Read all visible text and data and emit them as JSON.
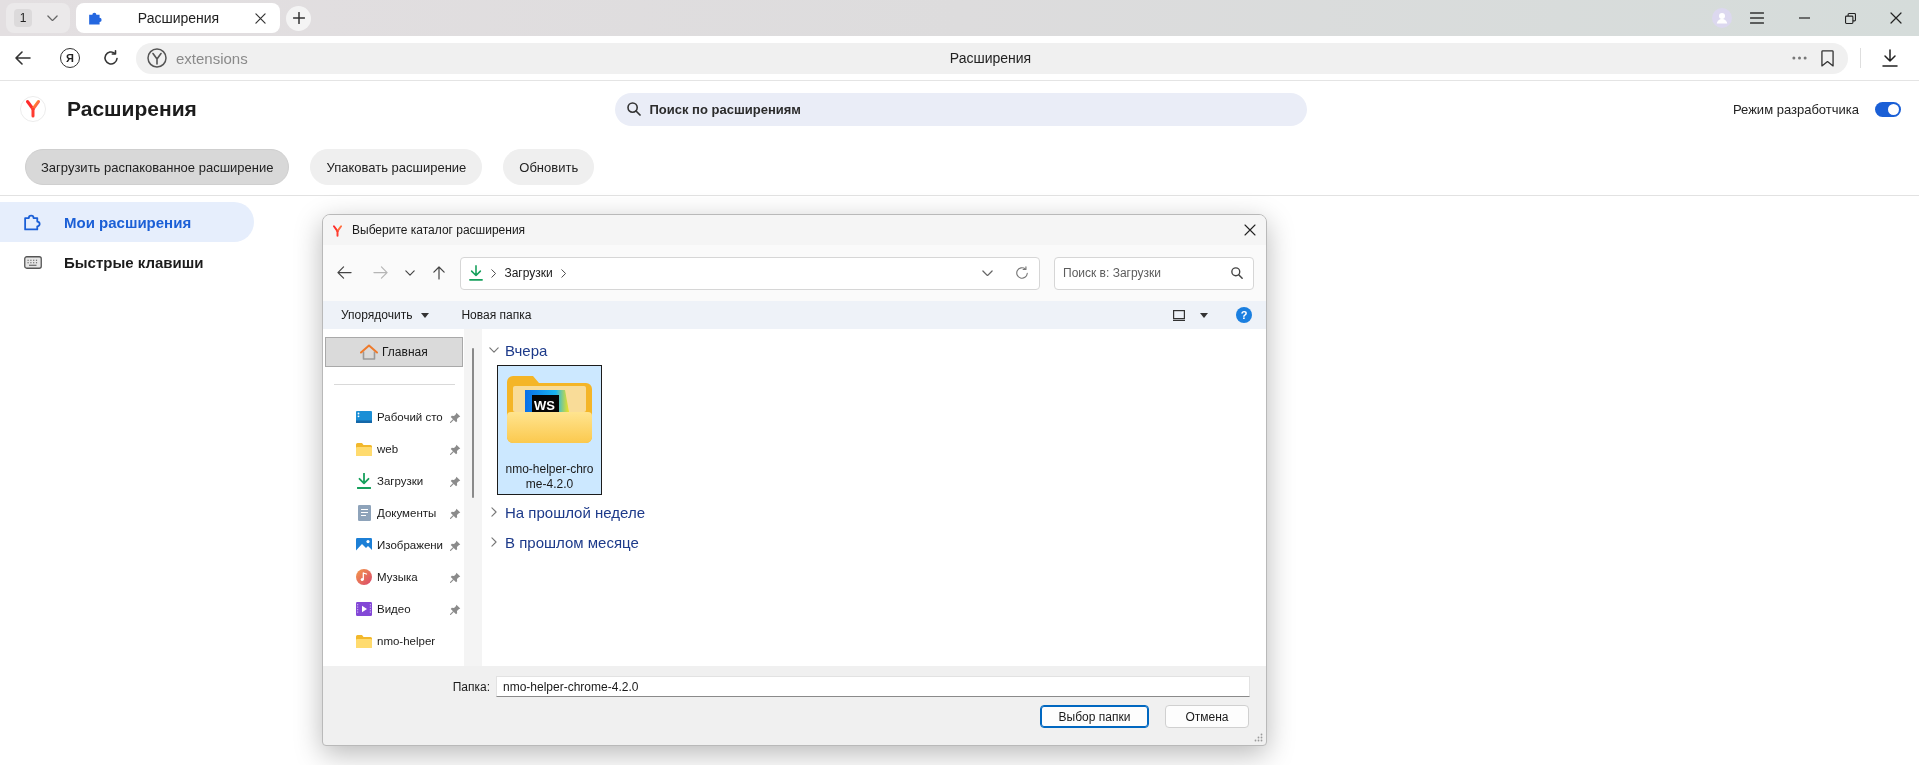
{
  "browser": {
    "tab_counter": "1",
    "tabs": [
      {
        "title": "Расширения",
        "selected": true
      }
    ],
    "yandex_button": "Я",
    "address": "extensions",
    "page_title": "Расширения"
  },
  "header": {
    "title": "Расширения",
    "search": {
      "placeholder": "Поиск по расширениям"
    },
    "developer_mode": {
      "label": "Режим разработчика",
      "on": true
    }
  },
  "actions": [
    {
      "label": "Загрузить распакованное расширение",
      "pressed": true
    },
    {
      "label": "Упаковать расширение",
      "pressed": false
    },
    {
      "label": "Обновить",
      "pressed": false
    }
  ],
  "sidebar": {
    "items": [
      {
        "label": "Мои расширения",
        "kind": "extensions",
        "selected": true
      },
      {
        "label": "Быстрые клавиши",
        "kind": "shortcuts",
        "selected": false
      }
    ]
  },
  "dialog": {
    "title": "Выберите каталог расширения",
    "back": {
      "disabled": false
    },
    "forward": {
      "disabled": true
    },
    "path": [
      "Загрузки"
    ],
    "search": {
      "placeholder": "Поиск в: Загрузки"
    },
    "toolbar": {
      "organize": "Упорядочить",
      "new_folder": "Новая папка",
      "help": "?"
    },
    "nav": {
      "home": {
        "label": "Главная",
        "selected": true
      },
      "quick_access": [
        {
          "label": "Рабочий сто",
          "kind": "desktop",
          "pinned": true
        },
        {
          "label": "web",
          "kind": "folder",
          "pinned": true
        },
        {
          "label": "Загрузки",
          "kind": "downloads",
          "pinned": true
        },
        {
          "label": "Документы",
          "kind": "documents",
          "pinned": true
        },
        {
          "label": "Изображени",
          "kind": "pictures",
          "pinned": true
        },
        {
          "label": "Музыка",
          "kind": "music",
          "pinned": true
        },
        {
          "label": "Видео",
          "kind": "video",
          "pinned": true
        },
        {
          "label": "nmo-helper",
          "kind": "folder",
          "pinned": false
        }
      ]
    },
    "groups": [
      {
        "label": "Вчера",
        "expanded": true,
        "items": [
          {
            "name": "nmo-helper-chrome-4.2.0",
            "badge": "WS",
            "selected": true
          }
        ]
      },
      {
        "label": "На прошлой неделе",
        "expanded": false
      },
      {
        "label": "В прошлом месяце",
        "expanded": false
      }
    ],
    "folder_field": {
      "label": "Папка:",
      "value": "nmo-helper-chrome-4.2.0"
    },
    "buttons": [
      {
        "label": "Выбор папки",
        "default": true
      },
      {
        "label": "Отмена",
        "default": false
      }
    ]
  }
}
